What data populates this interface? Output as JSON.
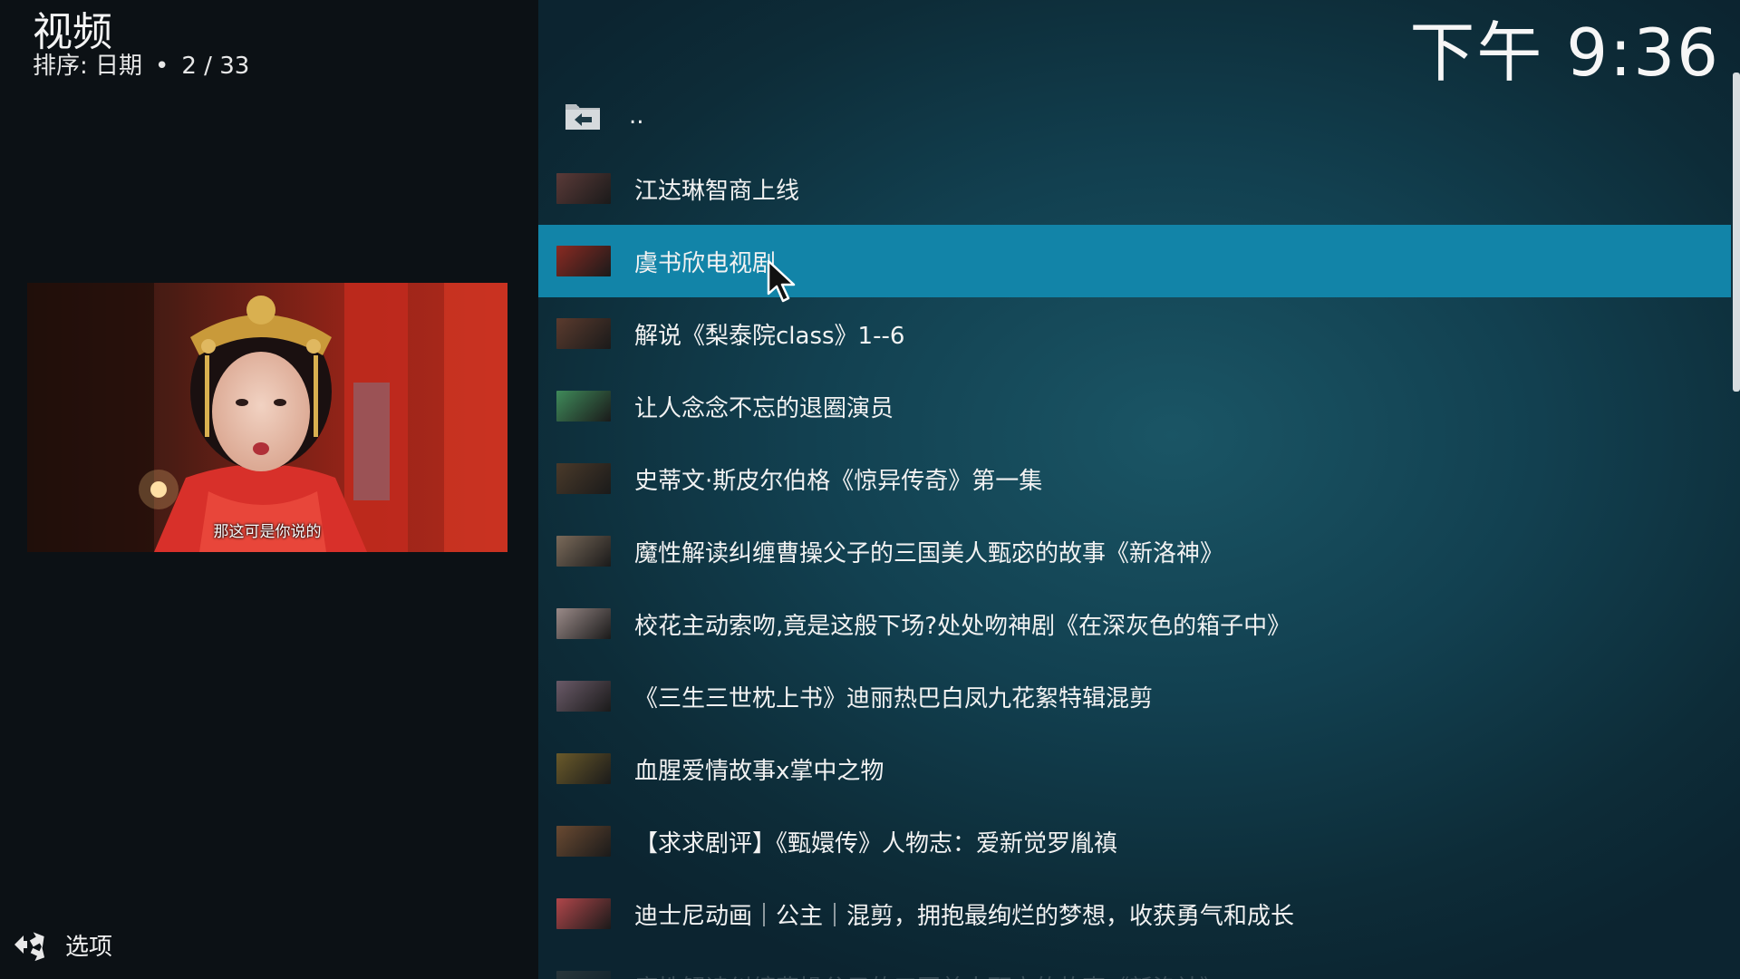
{
  "header": {
    "title": "视频",
    "sort_label": "排序: 日期",
    "position": "2 / 33"
  },
  "clock": "下午 9:36",
  "preview": {
    "subtitle": "那这可是你说的"
  },
  "options": {
    "label": "选项",
    "icon": "options-arrows-icon"
  },
  "list": {
    "parent_label": "..",
    "parent_icon": "folder-back-icon",
    "selected_index": 1,
    "items": [
      {
        "label": "江达琳智商上线",
        "thumb_color": "#5a3a38"
      },
      {
        "label": "虞书欣电视剧",
        "thumb_color": "#8a2a22"
      },
      {
        "label": "解说《梨泰院class》1--6",
        "thumb_color": "#5b3b2e"
      },
      {
        "label": "让人念念不忘的退圈演员",
        "thumb_color": "#3f8a5a"
      },
      {
        "label": "史蒂文·斯皮尔伯格《惊异传奇》第一集",
        "thumb_color": "#4a3a2a"
      },
      {
        "label": "魔性解读纠缠曹操父子的三国美人甄宓的故事《新洛神》",
        "thumb_color": "#7a6a5a"
      },
      {
        "label": "校花主动索吻,竟是这般下场?处处吻神剧《在深灰色的箱子中》",
        "thumb_color": "#9a8a88"
      },
      {
        "label": "《三生三世枕上书》迪丽热巴白凤九花絮特辑混剪",
        "thumb_color": "#6a5a68"
      },
      {
        "label": "血腥爱情故事x掌中之物",
        "thumb_color": "#6a5a2a"
      },
      {
        "label": "【求求剧评】《甄嬛传》人物志：爱新觉罗胤禛",
        "thumb_color": "#6a4a32"
      },
      {
        "label": "迪士尼动画｜公主｜混剪，拥抱最绚烂的梦想，收获勇气和成长",
        "thumb_color": "#b0464a"
      },
      {
        "label": "魔性解读纠缠曹操父子的三国美人甄宓的故事《新洛神》",
        "thumb_color": "#7a6a5a"
      }
    ]
  },
  "colors": {
    "selected_row": "#1284a8",
    "left_bg": "#0c1115",
    "right_bg": "#124050"
  }
}
